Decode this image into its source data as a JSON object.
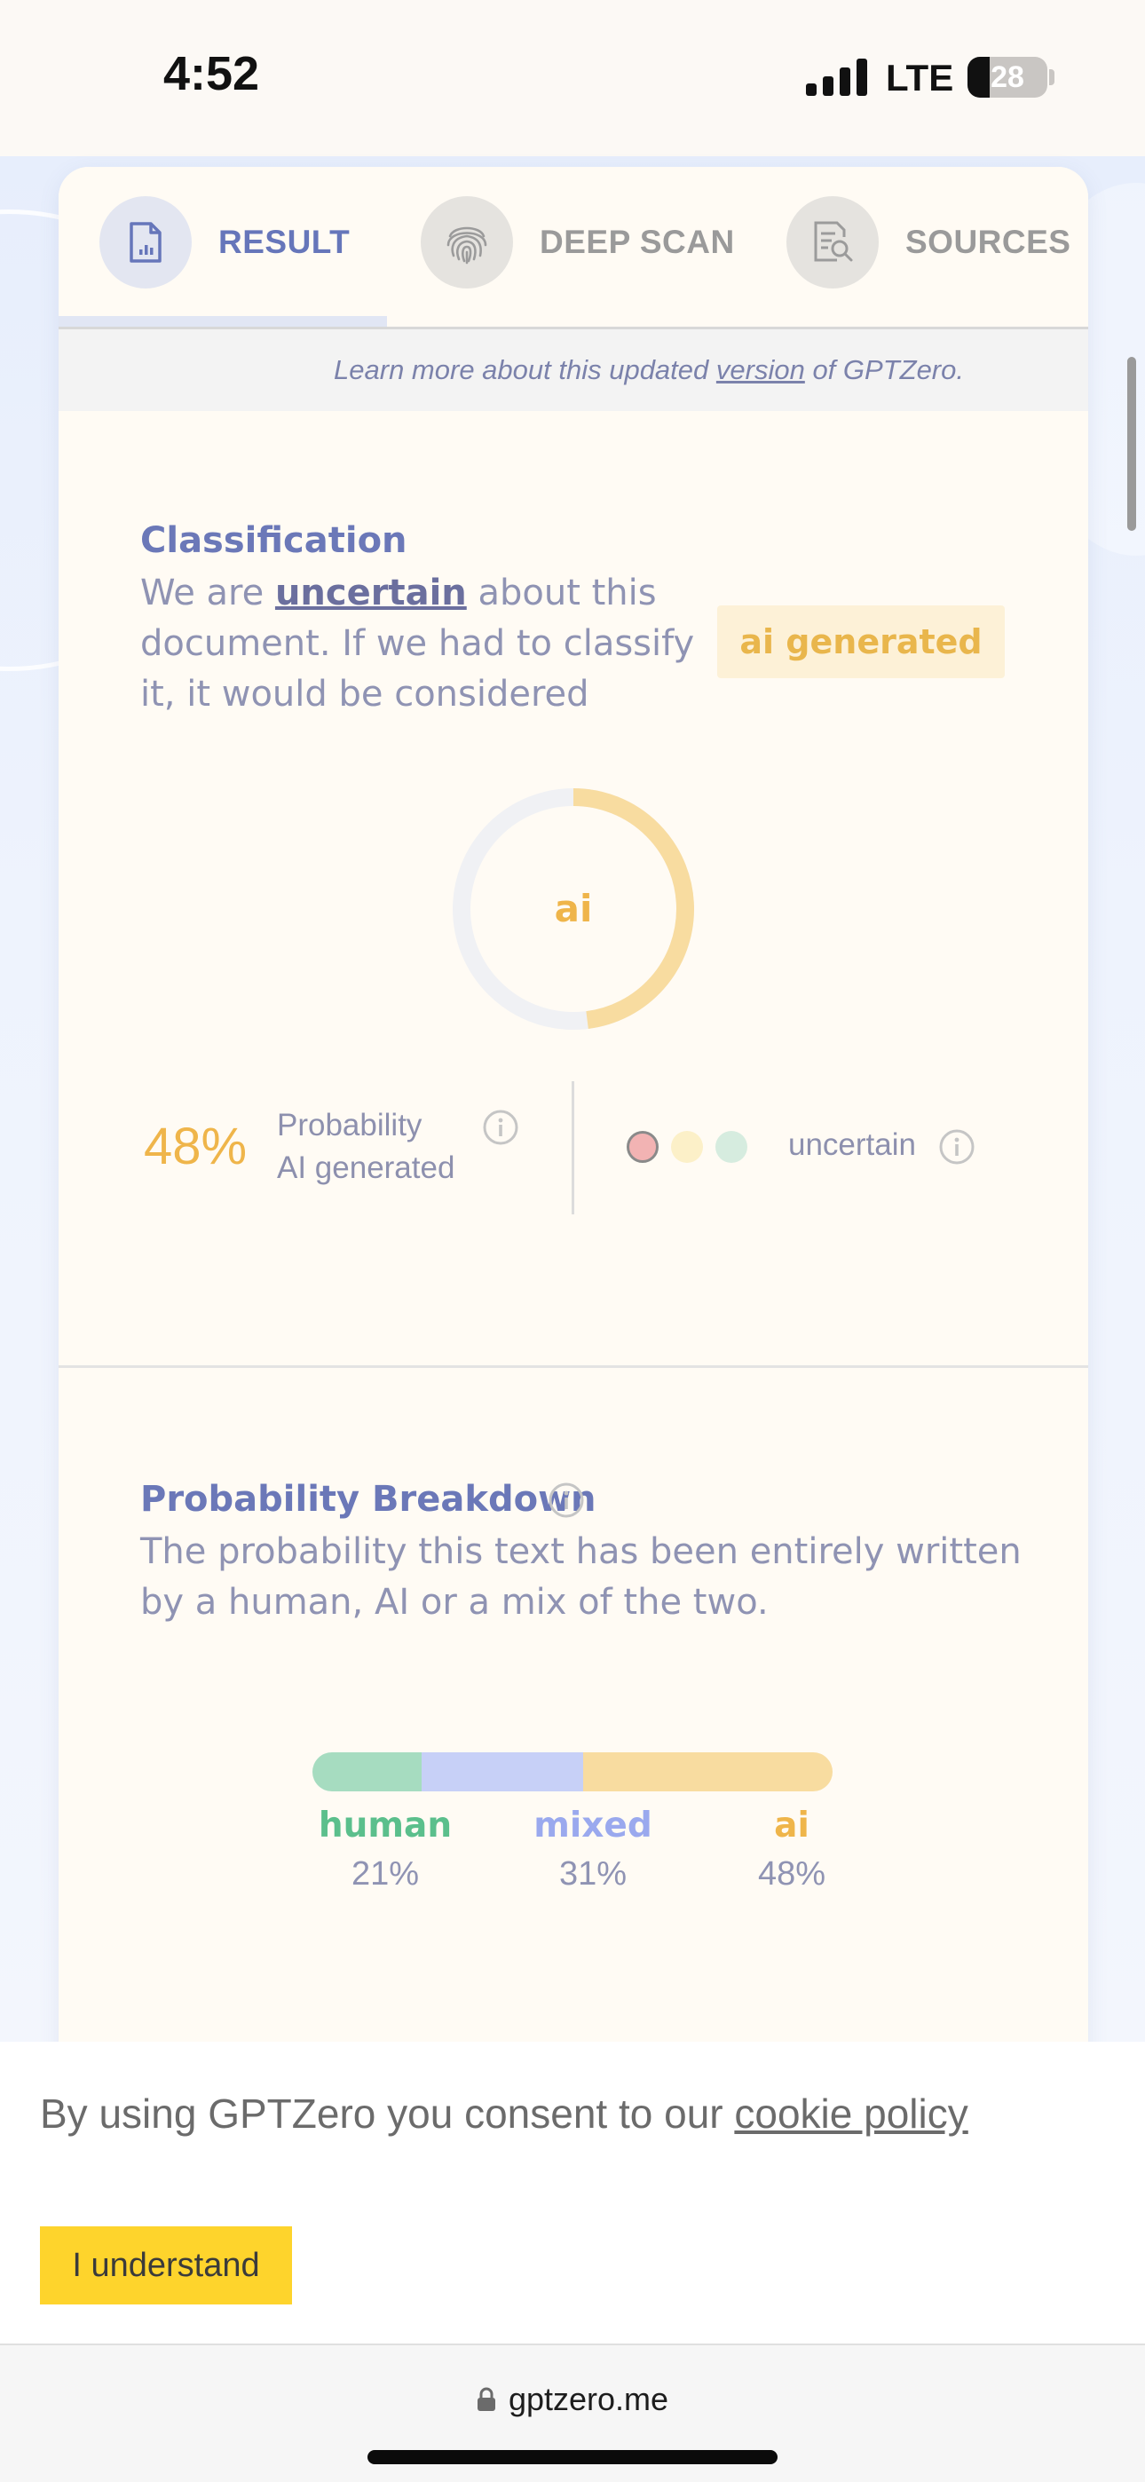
{
  "status_bar": {
    "time": "4:52",
    "network": "LTE",
    "battery": "28",
    "battery_level": 0.28
  },
  "tabs": [
    {
      "label": "RESULT",
      "icon": "document-chart-icon",
      "active": true
    },
    {
      "label": "DEEP SCAN",
      "icon": "fingerprint-icon",
      "active": false
    },
    {
      "label": "SOURCES",
      "icon": "document-search-icon",
      "active": false
    }
  ],
  "notice": {
    "before": "Learn more about this updated ",
    "link": "version",
    "after": " of GPTZero."
  },
  "classification": {
    "title": "Classification",
    "text_before": "We are ",
    "text_link": "uncertain",
    "text_after": " about this document. If we had to classify it, it would be considered",
    "badge": "ai generated",
    "donut_label": "ai",
    "donut_fraction": 0.48,
    "probability": "48%",
    "probability_label_1": "Probability",
    "probability_label_2": "AI generated",
    "confidence_label": "uncertain",
    "confidence_dots": [
      "#f2b3b3",
      "#fcf0c8",
      "#d6ecdf"
    ]
  },
  "breakdown": {
    "title": "Probability Breakdown",
    "text": "The probability this text has been entirely written by a human, AI or a mix of the two.",
    "items": [
      {
        "label": "human",
        "value": "21%",
        "fraction": 0.21,
        "color": "#a6dcc0",
        "text_color": "#5bbf8c"
      },
      {
        "label": "mixed",
        "value": "31%",
        "fraction": 0.31,
        "color": "#c7d0f7",
        "text_color": "#9aa9ee"
      },
      {
        "label": "ai",
        "value": "48%",
        "fraction": 0.48,
        "color": "#f8dca0",
        "text_color": "#efb54a"
      }
    ]
  },
  "cookie": {
    "text": "By using GPTZero you consent to our ",
    "link": "cookie policy",
    "button": "I understand"
  },
  "browser": {
    "url": "gptzero.me"
  },
  "colors": {
    "accent": "#6676ba",
    "ai": "#efb54a",
    "button": "#fed42c"
  }
}
